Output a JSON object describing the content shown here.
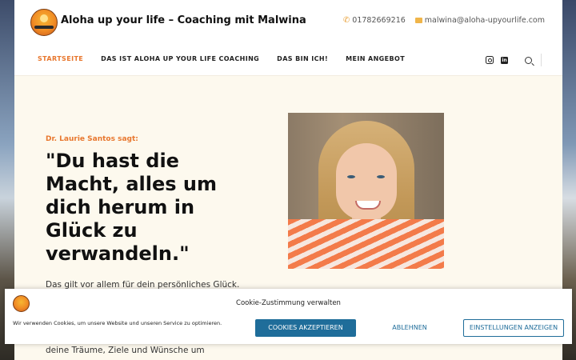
{
  "header": {
    "site_title": "Aloha up your life – Coaching mit Malwina",
    "phone": "01782669216",
    "email": "malwina@aloha-upyourlife.com"
  },
  "nav": {
    "items": [
      {
        "label": "STARTSEITE",
        "active": true
      },
      {
        "label": "DAS IST ALOHA UP YOUR LIFE COACHING",
        "active": false
      },
      {
        "label": "DAS BIN ICH!",
        "active": false
      },
      {
        "label": "MEIN ANGEBOT",
        "active": false
      }
    ]
  },
  "hero": {
    "eyebrow": "Dr. Laurie Santos sagt:",
    "quote": "\"Du hast die Macht, alles um dich herum in Glück zu verwandeln.\"",
    "subtext": "Das gilt vor allem für dein persönliches Glück.",
    "subtext_partial": "deine Träume, Ziele und Wünsche um"
  },
  "cookie_banner": {
    "title": "Cookie-Zustimmung verwalten",
    "text": "Wir verwenden Cookies, um unsere Website und unseren Service zu optimieren.",
    "accept_label": "COOKIES AKZEPTIEREN",
    "deny_label": "ABLEHNEN",
    "settings_label": "EINSTELLUNGEN ANZEIGEN"
  },
  "colors": {
    "accent": "#e8772e",
    "button_blue": "#1f6d9a",
    "hero_bg": "#fdf9ee"
  }
}
